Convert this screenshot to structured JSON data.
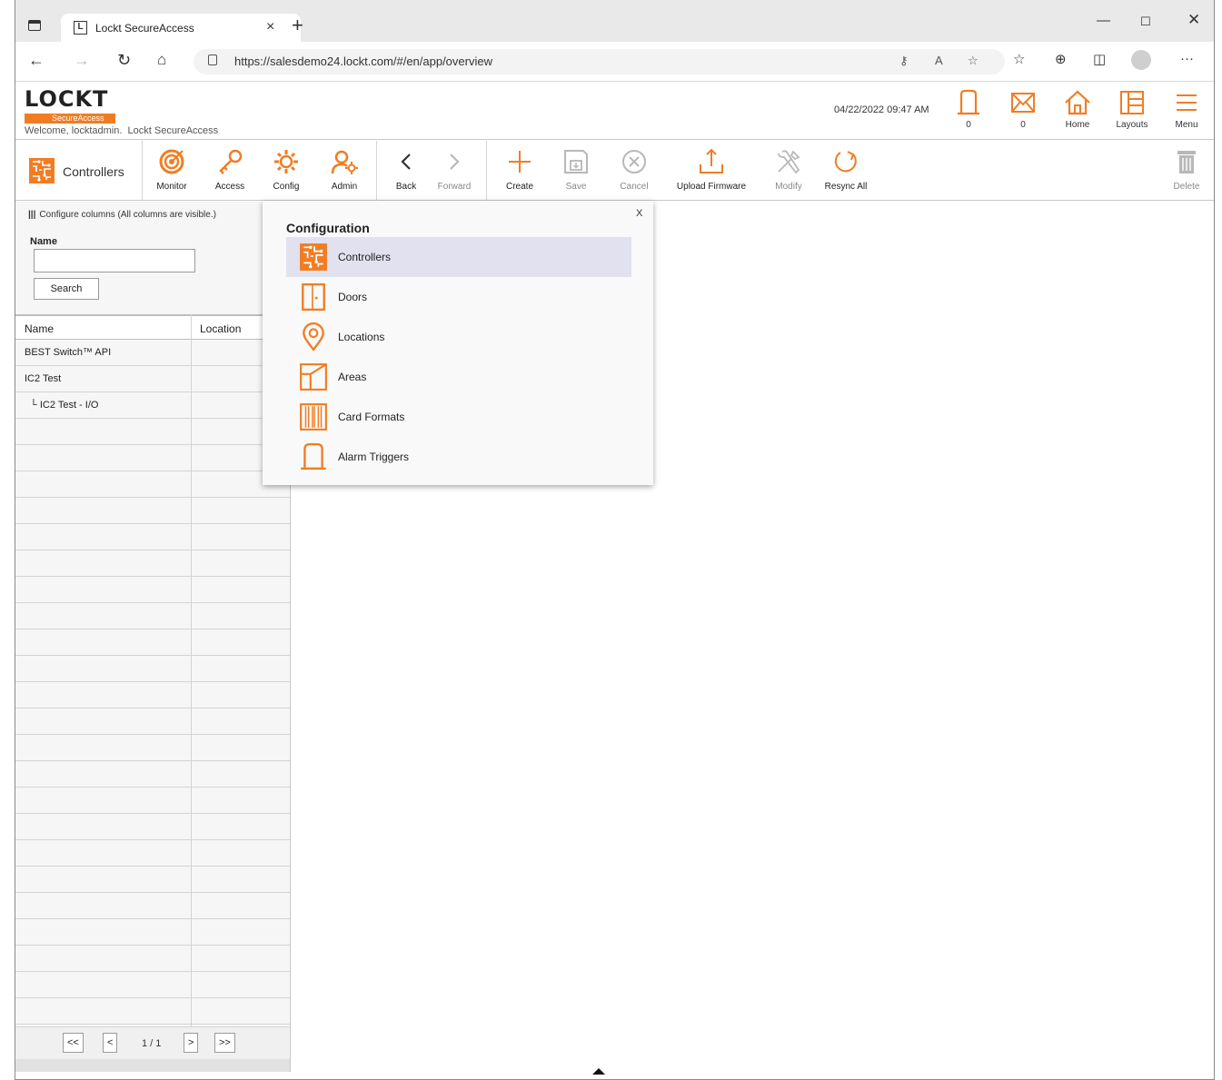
{
  "browser": {
    "tab_title": "Lockt SecureAccess",
    "tab_favicon_letter": "L",
    "url": "https://salesdemo24.lockt.com/#/en/app/overview"
  },
  "header": {
    "logo_text": "LOCKT",
    "logo_sub": "SecureAccess",
    "welcome": "Welcome, locktadmin.",
    "app_name": "Lockt SecureAccess",
    "datetime": "04/22/2022 09:47 AM",
    "alarms_count": "0",
    "messages_count": "0",
    "home_label": "Home",
    "layouts_label": "Layouts",
    "menu_label": "Menu"
  },
  "toolbar": {
    "page_title": "Controllers",
    "monitor": "Monitor",
    "access": "Access",
    "config": "Config",
    "admin": "Admin",
    "back": "Back",
    "forward": "Forward",
    "create": "Create",
    "save": "Save",
    "cancel": "Cancel",
    "upload_firmware": "Upload Firmware",
    "modify": "Modify",
    "resync_all": "Resync All",
    "delete": "Delete"
  },
  "left_panel": {
    "configure_columns": "Configure columns (All columns are visible.)",
    "name_label": "Name",
    "name_value": "",
    "search_button": "Search",
    "columns": [
      "Name",
      "Location"
    ],
    "rows": [
      "BEST Switch™ API",
      "IC2 Test",
      "└ IC2 Test - I/O"
    ],
    "pager": {
      "first": "<<",
      "prev": "<",
      "page_text": "1 / 1",
      "next": ">",
      "last": ">>"
    }
  },
  "popup": {
    "title": "Configuration",
    "close": "X",
    "items": [
      {
        "label": "Controllers",
        "icon": "controller-icon",
        "active": true
      },
      {
        "label": "Doors",
        "icon": "door-icon",
        "active": false
      },
      {
        "label": "Locations",
        "icon": "location-pin-icon",
        "active": false
      },
      {
        "label": "Areas",
        "icon": "area-icon",
        "active": false
      },
      {
        "label": "Card Formats",
        "icon": "card-format-icon",
        "active": false
      },
      {
        "label": "Alarm Triggers",
        "icon": "alarm-trigger-icon",
        "active": false
      }
    ]
  },
  "colors": {
    "accent": "#f07d24",
    "disabled": "#b8b8b8",
    "active_item_bg": "#e1e1ef"
  }
}
